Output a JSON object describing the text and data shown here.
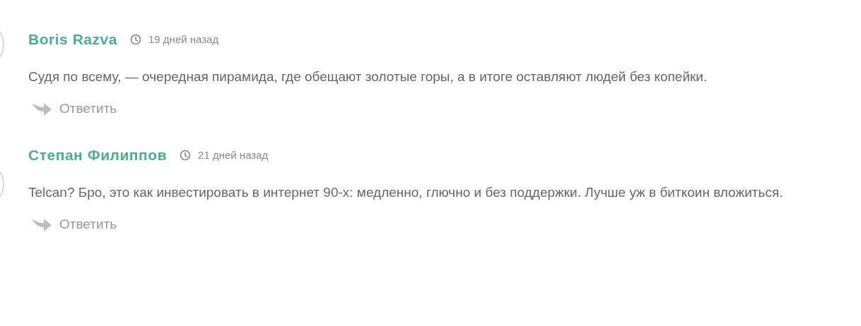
{
  "comments": [
    {
      "author": "Boris Razva",
      "time": "19 дней назад",
      "text": "Судя по всему, — очередная пирамида, где обещают золотые горы, а в итоге оставляют людей без копейки.",
      "reply": "Ответить"
    },
    {
      "author": "Степан Филиппов",
      "time": "21 дней назад",
      "text": "Telcan? Бро, это как инвестировать в интернет 90-х: медленно, глючно и без поддержки. Лучше уж в биткоин вложиться.",
      "reply": "Ответить"
    }
  ]
}
